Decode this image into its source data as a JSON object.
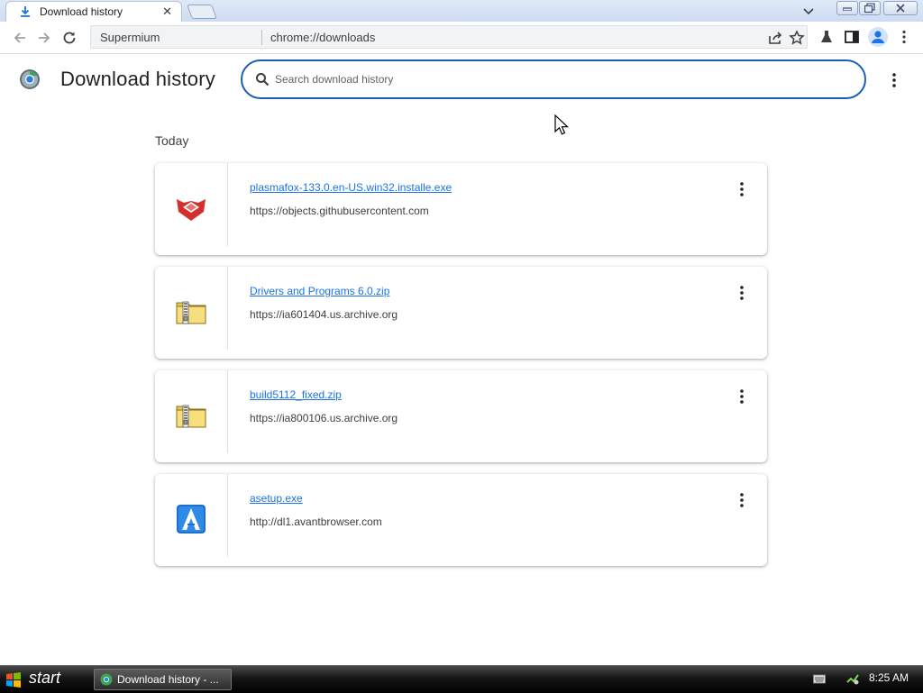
{
  "tab": {
    "title": "Download history",
    "icon": "download-icon",
    "close": "✕"
  },
  "omnibox": {
    "chip": "Supermium",
    "url": "chrome://downloads"
  },
  "page": {
    "title": "Download history"
  },
  "search": {
    "placeholder": "Search download history",
    "value": ""
  },
  "section": {
    "label": "Today"
  },
  "downloads": [
    {
      "name": "plasmafox-133.0.en-US.win32.installe.exe",
      "url": "https://objects.githubusercontent.com",
      "icon": "plasmafox-icon"
    },
    {
      "name": "Drivers and Programs 6.0.zip",
      "url": "https://ia601404.us.archive.org",
      "icon": "zip-folder-icon"
    },
    {
      "name": "build5112_fixed.zip",
      "url": "https://ia800106.us.archive.org",
      "icon": "zip-folder-icon"
    },
    {
      "name": "asetup.exe",
      "url": "http://dl1.avantbrowser.com",
      "icon": "avant-browser-icon"
    }
  ],
  "taskbar": {
    "start": "start",
    "task": "Download history - ...",
    "clock": "8:25 AM"
  },
  "colors": {
    "accent": "#1a73e8",
    "search_border": "#1a5fb4",
    "tab_strip": "#d6e2f4"
  }
}
